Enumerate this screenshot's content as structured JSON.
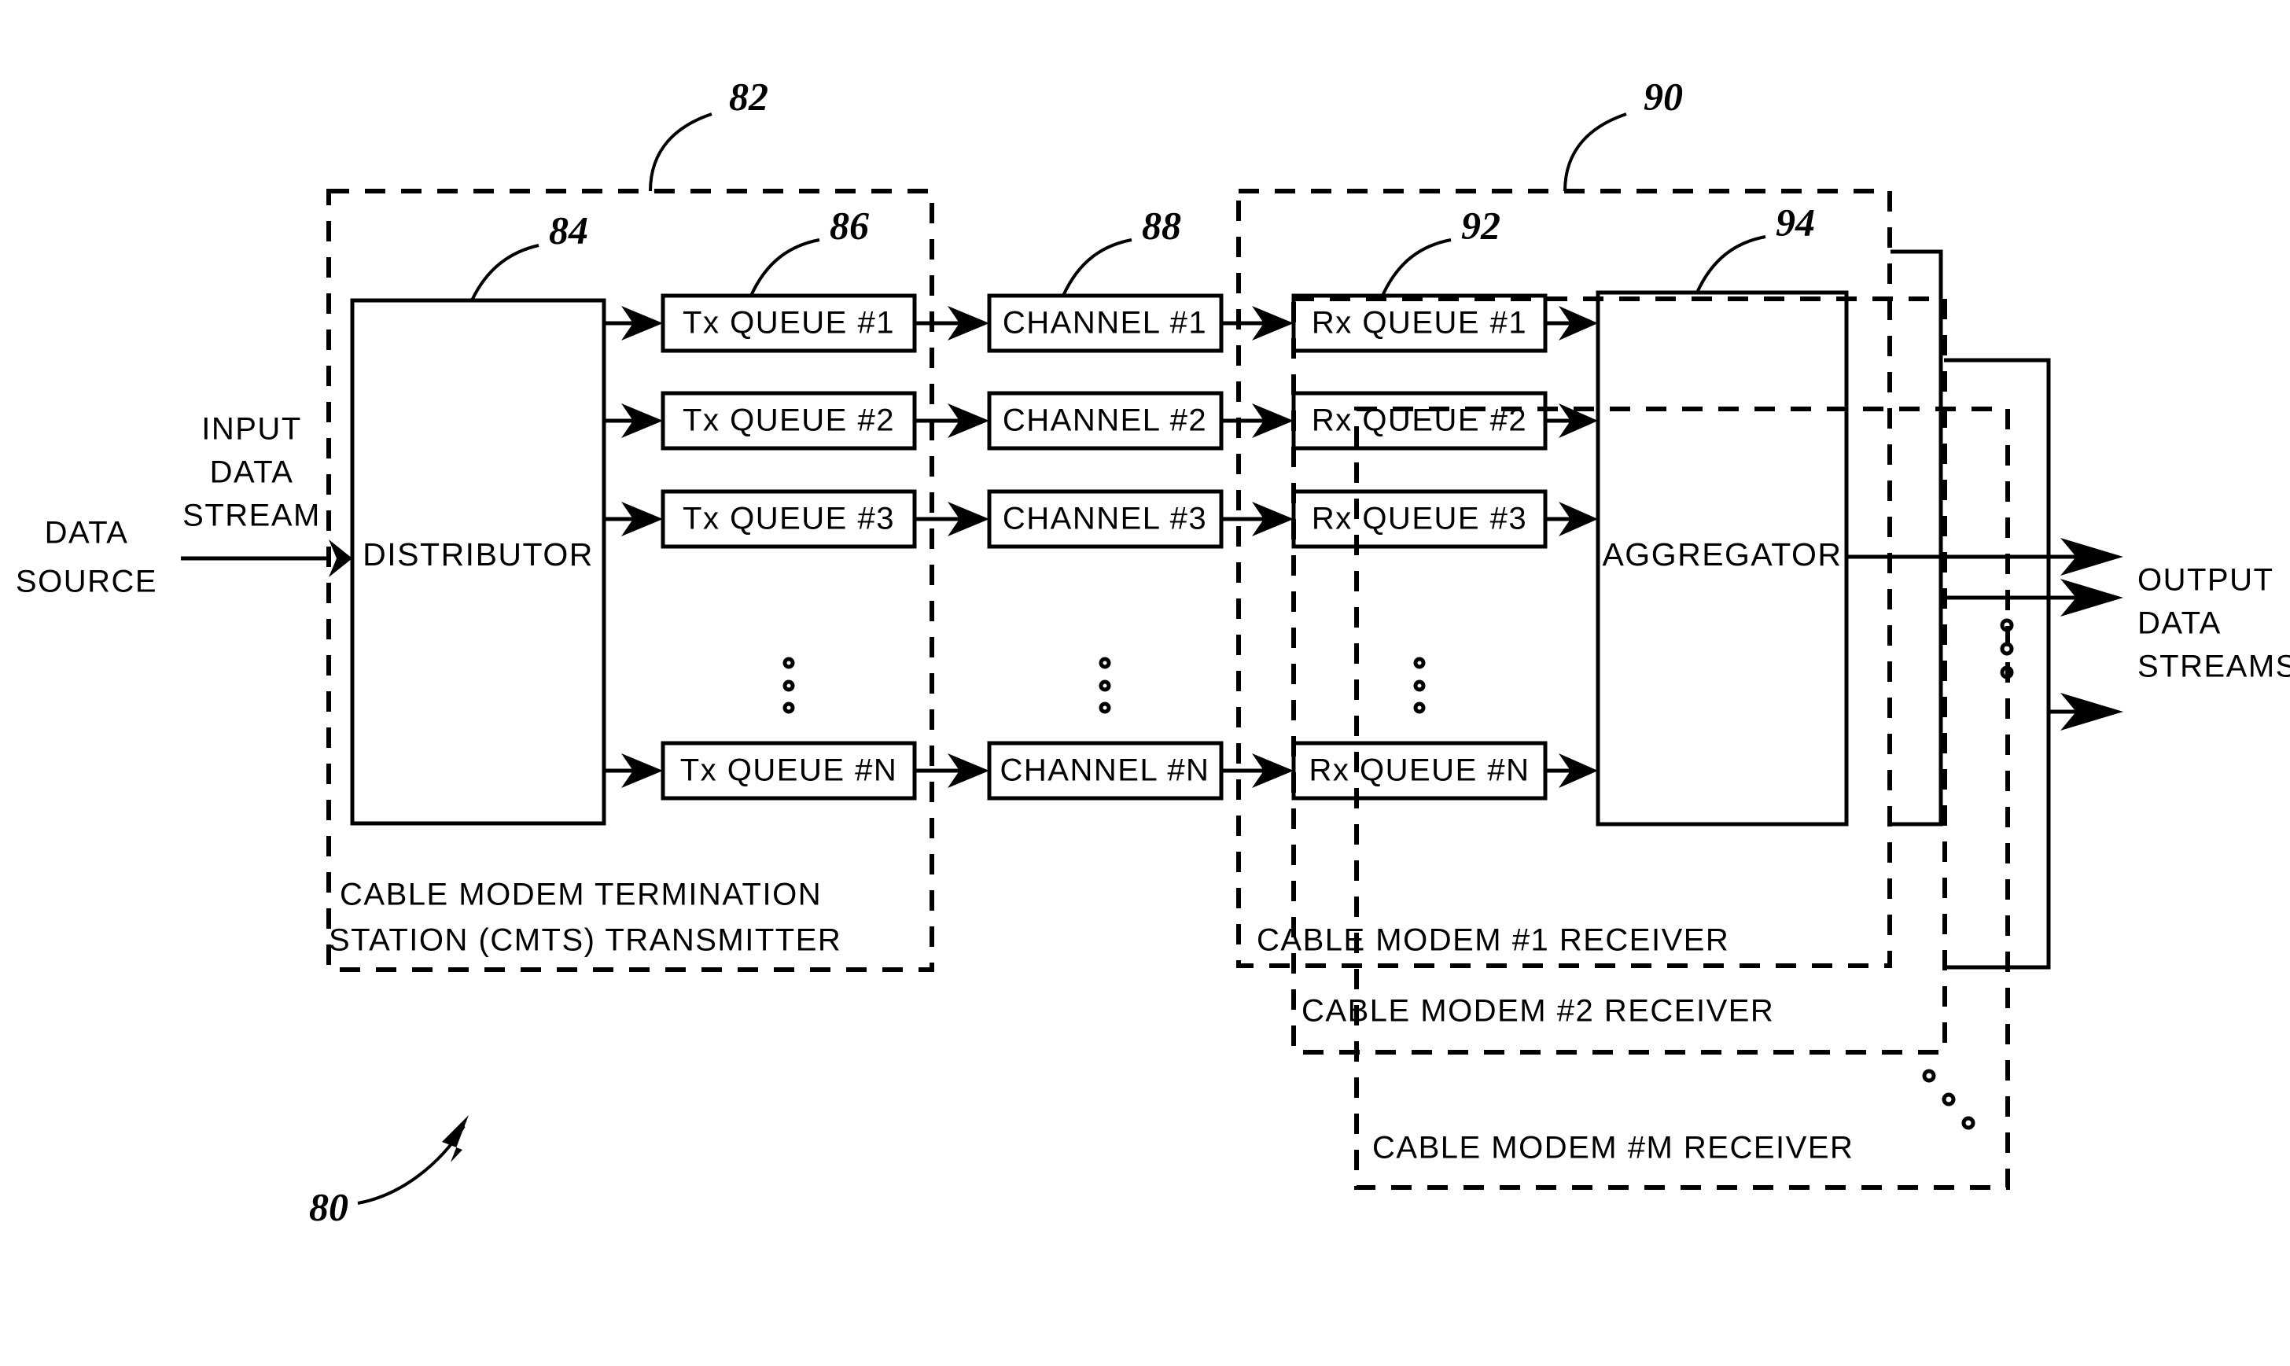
{
  "figure": {
    "ref_main": "80",
    "ref_cmts": "82",
    "ref_distributor": "84",
    "ref_tx_queue": "86",
    "ref_channel": "88",
    "ref_modem": "90",
    "ref_rx_queue": "92",
    "ref_aggregator": "94"
  },
  "source": {
    "line1": "DATA",
    "line2": "SOURCE"
  },
  "input_stream": {
    "line1": "INPUT",
    "line2": "DATA",
    "line3": "STREAM"
  },
  "output_stream": {
    "line1": "OUTPUT",
    "line2": "DATA",
    "line3": "STREAMS"
  },
  "cmts": {
    "caption_line1": "CABLE MODEM TERMINATION",
    "caption_line2": "STATION (CMTS) TRANSMITTER",
    "distributor_label": "DISTRIBUTOR"
  },
  "modems": {
    "caption_1": "CABLE MODEM #1 RECEIVER",
    "caption_2": "CABLE MODEM #2 RECEIVER",
    "caption_m": "CABLE MODEM #M RECEIVER",
    "aggregator_label": "AGGREGATOR"
  },
  "tx_queues": [
    {
      "label": "Tx  QUEUE  #1"
    },
    {
      "label": "Tx  QUEUE  #2"
    },
    {
      "label": "Tx  QUEUE  #3"
    },
    {
      "label": "Tx  QUEUE  #N"
    }
  ],
  "channels": [
    {
      "label": "CHANNEL  #1"
    },
    {
      "label": "CHANNEL  #2"
    },
    {
      "label": "CHANNEL  #3"
    },
    {
      "label": "CHANNEL  #N"
    }
  ],
  "rx_queues": [
    {
      "label": "Rx  QUEUE  #1"
    },
    {
      "label": "Rx  QUEUE  #2"
    },
    {
      "label": "Rx  QUEUE  #3"
    },
    {
      "label": "Rx  QUEUE  #N"
    }
  ]
}
